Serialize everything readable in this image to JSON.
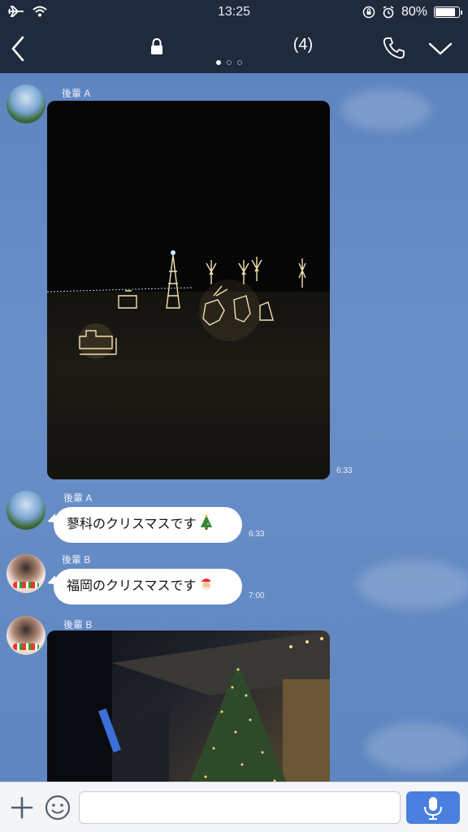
{
  "status": {
    "time": "13:25",
    "battery": "80%",
    "battery_level": 0.8
  },
  "header": {
    "member_count": "(4)",
    "page_indicator": {
      "total": 3,
      "active": 1
    }
  },
  "messages": [
    {
      "type": "photo",
      "sender": "後輩 A",
      "time": "6:33"
    },
    {
      "type": "text",
      "sender": "後輩 A",
      "text": "蓼科のクリスマスです",
      "emoji": "christmas-tree",
      "time": "6:33"
    },
    {
      "type": "text",
      "sender": "後輩 B",
      "text": "福岡のクリスマスです",
      "emoji": "santa-face",
      "time": "7:00"
    },
    {
      "type": "photo",
      "sender": "後輩 B",
      "time": ""
    }
  ],
  "input": {
    "placeholder": ""
  },
  "colors": {
    "header_bg": "#1f2a3d",
    "chat_bg": "#6a8fc4",
    "send_button": "#4a7fe0"
  }
}
